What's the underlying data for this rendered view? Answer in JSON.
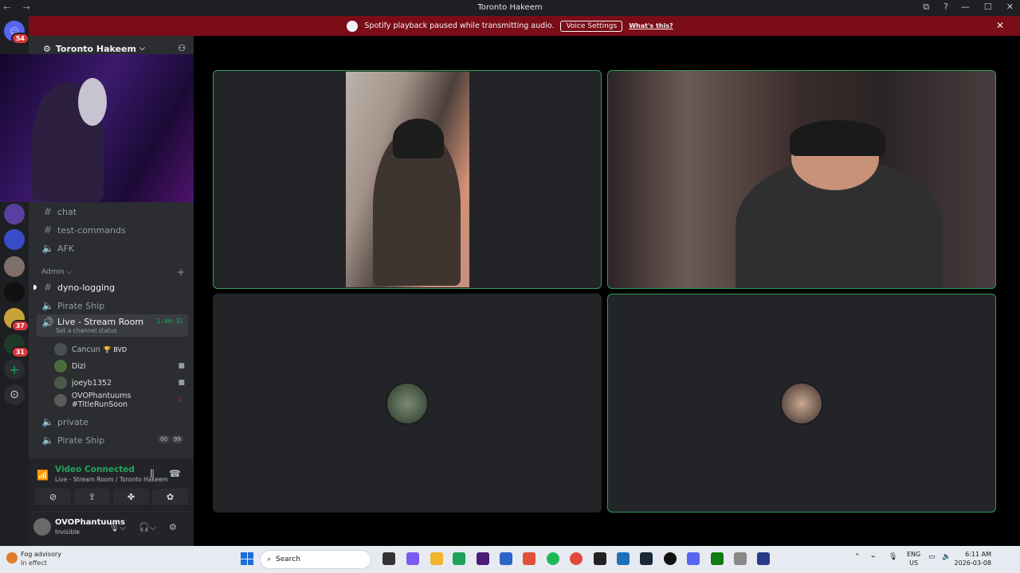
{
  "window": {
    "title": "Toronto Hakeem",
    "nav_arrows": "←  →",
    "controls": [
      "—",
      "☐",
      "✕"
    ],
    "top_icons": [
      "⧉",
      "?"
    ]
  },
  "banner": {
    "message": "Spotify playback paused while transmitting audio.",
    "voice_settings": "Voice Settings",
    "whats_this": "What's this?",
    "close": "✕",
    "color": "#7a0d17"
  },
  "servers": {
    "home_badge": "54",
    "badges": [
      {
        "label": "37"
      },
      {
        "label": "31"
      }
    ],
    "add": "+",
    "discover": "⊙"
  },
  "server": {
    "name": "Toronto Hakeem",
    "caret": "⌵"
  },
  "channels": {
    "chat": "chat",
    "test_commands": "test-commands",
    "afk": "AFK",
    "admin_category": "Admin",
    "dyno_logging": "dyno-logging",
    "pirate_ship_1": "Pirate Ship",
    "live_stream_room": "Live - Stream Room",
    "live_status": "Set a channel status",
    "live_timer": "1:40:31",
    "private": "private",
    "pirate_ship_2": "Pirate Ship",
    "pirate_pills": [
      "00",
      "99"
    ]
  },
  "voice_users": [
    {
      "name": "Cancun",
      "tag": "🏆 BVD",
      "camera": ""
    },
    {
      "name": "Dizi",
      "tag": "",
      "camera": "■"
    },
    {
      "name": "joeyb1352",
      "tag": "",
      "camera": "■"
    },
    {
      "name": "OVOPhantuums #TitleRunSoon",
      "tag": "",
      "camera": "☾"
    }
  ],
  "voice_panel": {
    "title": "Video Connected",
    "subtitle": "Live - Stream Room / Toronto Hakeem",
    "buttons": [
      "⊘",
      "⇪",
      "✤",
      "✿"
    ]
  },
  "user": {
    "name": "OVOPhantuums",
    "status": "Invisible"
  },
  "taskbar": {
    "weather_title": "Fog advisory",
    "weather_sub": "In effect",
    "weather_badge": "1",
    "search_placeholder": "Search",
    "lang_1": "ENG",
    "lang_2": "US",
    "time": "6:11 AM",
    "date": "2026-03-08"
  }
}
